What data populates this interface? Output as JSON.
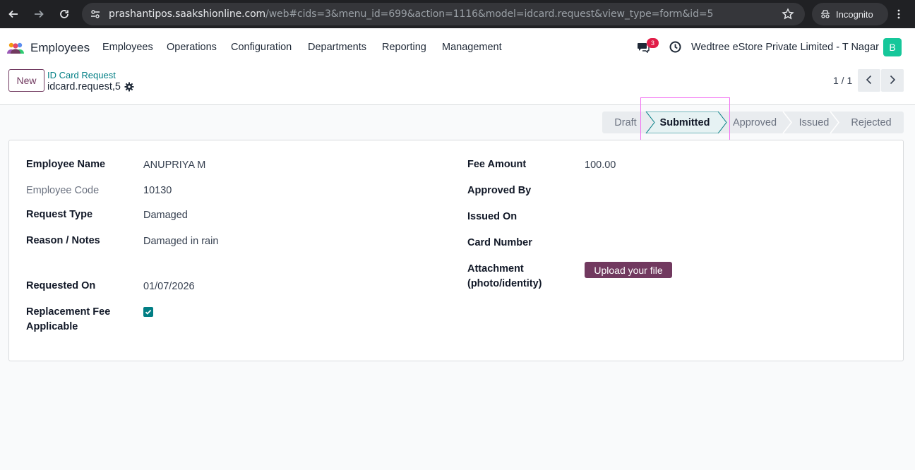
{
  "browser": {
    "url_host": "prashantipos.saakshionline.com",
    "url_rest": "/web#cids=3&menu_id=699&action=1116&model=idcard.request&view_type=form&id=5",
    "incognito_label": "Incognito",
    "icons": [
      "back-icon",
      "forward-icon",
      "reload-icon",
      "site-info-icon",
      "star-icon",
      "incognito-icon",
      "kebab-menu-icon"
    ]
  },
  "topnav": {
    "app_name": "Employees",
    "menu": [
      "Employees",
      "Operations",
      "Configuration",
      "Departments",
      "Reporting",
      "Management"
    ],
    "messages_badge": "3",
    "company": "Wedtree eStore Private Limited - T Nagar",
    "avatar_letter": "B"
  },
  "control": {
    "new_label": "New",
    "breadcrumb_parent": "ID Card Request",
    "breadcrumb_current": "idcard.request,5",
    "pager": "1 / 1"
  },
  "statusbar": {
    "stages": [
      "Draft",
      "Submitted",
      "Approved",
      "Issued",
      "Rejected"
    ],
    "active": "Submitted"
  },
  "form": {
    "left": {
      "employee_name_label": "Employee Name",
      "employee_name": "ANUPRIYA M",
      "employee_code_label": "Employee Code",
      "employee_code": "10130",
      "request_type_label": "Request Type",
      "request_type": "Damaged",
      "reason_label": "Reason / Notes",
      "reason": "Damaged in rain",
      "requested_on_label": "Requested On",
      "requested_on": "01/07/2026",
      "replacement_fee_label_1": "Replacement Fee",
      "replacement_fee_label_2": "Applicable",
      "replacement_fee_checked": true
    },
    "right": {
      "fee_amount_label": "Fee Amount",
      "fee_amount": "100.00",
      "approved_by_label": "Approved By",
      "issued_on_label": "Issued On",
      "card_number_label": "Card Number",
      "attachment_label_1": "Attachment",
      "attachment_label_2": "(photo/identity)",
      "upload_label": "Upload your file"
    }
  },
  "colors": {
    "brand": "#71395f",
    "teal": "#017e84",
    "active_stage_bg": "#e6f2f3",
    "highlight": "#f26ff2"
  }
}
